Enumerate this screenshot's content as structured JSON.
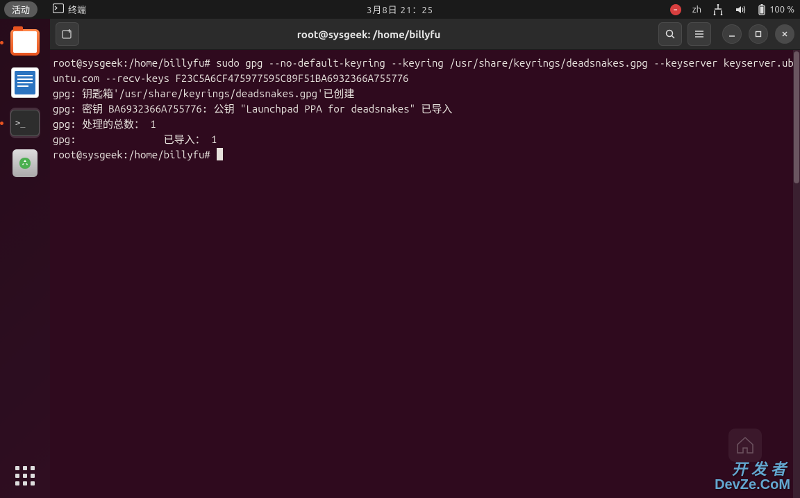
{
  "topbar": {
    "activities": "活动",
    "app_name": "终端",
    "datetime": "3月8日  21：25",
    "input_method": "zh",
    "battery": "100 %"
  },
  "dock": {
    "items": [
      {
        "name": "files",
        "label": "文件"
      },
      {
        "name": "writer",
        "label": "LibreOffice Writer"
      },
      {
        "name": "terminal",
        "label": "终端"
      },
      {
        "name": "trash",
        "label": "回收站"
      }
    ]
  },
  "window": {
    "title": "root@sysgeek: /home/billyfu"
  },
  "terminal": {
    "lines": [
      "root@sysgeek:/home/billyfu# sudo gpg --no-default-keyring --keyring /usr/share/keyrings/deadsnakes.gpg --keyserver keyserver.ubuntu.com --recv-keys F23C5A6CF475977595C89F51BA6932366A755776",
      "gpg: 钥匙箱'/usr/share/keyrings/deadsnakes.gpg'已创建",
      "gpg: 密钥 BA6932366A755776: 公钥 \"Launchpad PPA for deadsnakes\" 已导入",
      "gpg: 处理的总数： 1",
      "gpg:               已导入： 1",
      "root@sysgeek:/home/billyfu# "
    ]
  },
  "watermark": {
    "line1": "开发者",
    "line2": "DevZe.CoM"
  }
}
